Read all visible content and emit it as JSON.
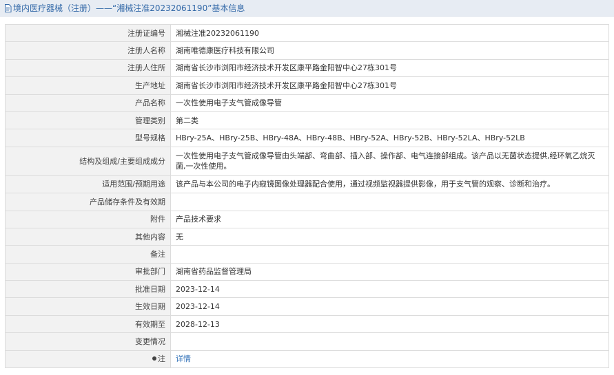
{
  "header": {
    "title": "境内医疗器械（注册）——“湘械注准20232061190”基本信息",
    "icon": "document-icon"
  },
  "rows": [
    {
      "label": "注册证编号",
      "value": "湘械注准20232061190"
    },
    {
      "label": "注册人名称",
      "value": "湖南唯德康医疗科技有限公司"
    },
    {
      "label": "注册人住所",
      "value": "湖南省长沙市浏阳市经济技术开发区康平路金阳智中心27栋301号"
    },
    {
      "label": "生产地址",
      "value": "湖南省长沙市浏阳市经济技术开发区康平路金阳智中心27栋301号"
    },
    {
      "label": "产品名称",
      "value": "一次性使用电子支气管成像导管"
    },
    {
      "label": "管理类别",
      "value": "第二类"
    },
    {
      "label": "型号规格",
      "value": "HBry-25A、HBry-25B、HBry-48A、HBry-48B、HBry-52A、HBry-52B、HBry-52LA、HBry-52LB"
    },
    {
      "label": "结构及组成/主要组成成分",
      "value": "一次性使用电子支气管成像导管由头端部、弯曲部、插入部、操作部、电气连接部组成。该产品以无菌状态提供,经环氧乙烷灭菌,一次性使用。"
    },
    {
      "label": "适用范围/预期用途",
      "value": "该产品与本公司的电子内窥镜图像处理器配合使用，通过视频监视器提供影像，用于支气管的观察、诊断和治疗。"
    },
    {
      "label": "产品储存条件及有效期",
      "value": ""
    },
    {
      "label": "附件",
      "value": "产品技术要求"
    },
    {
      "label": "其他内容",
      "value": "无"
    },
    {
      "label": "备注",
      "value": ""
    },
    {
      "label": "审批部门",
      "value": "湖南省药品监督管理局"
    },
    {
      "label": "批准日期",
      "value": "2023-12-14"
    },
    {
      "label": "生效日期",
      "value": "2023-12-14"
    },
    {
      "label": "有效期至",
      "value": "2028-12-13"
    },
    {
      "label": "变更情况",
      "value": ""
    }
  ],
  "note": {
    "label": "注",
    "icon": "pin-icon",
    "link": "详情"
  },
  "colors": {
    "header_bg": "#e7ecf3",
    "title_text": "#3369a8",
    "label_bg": "#f2f2f2",
    "link": "#2f6fb7"
  }
}
